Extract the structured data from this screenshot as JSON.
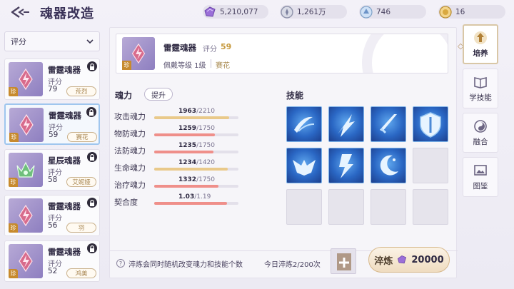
{
  "header": {
    "title": "魂器改造",
    "currencies": [
      {
        "icon": "purple-gem-icon",
        "value": "5,210,077"
      },
      {
        "icon": "silver-coin-icon",
        "value": "1,261万"
      },
      {
        "icon": "blue-crystal-icon",
        "value": "746"
      },
      {
        "icon": "gold-medal-icon",
        "value": "16"
      }
    ]
  },
  "filter": {
    "selected": "评分"
  },
  "list": {
    "items": [
      {
        "name": "雷霆魂器",
        "score_label": "评分",
        "score": "79",
        "owner": "荒烈",
        "rarity": "珍",
        "locked": true
      },
      {
        "name": "雷霆魂器",
        "score_label": "评分",
        "score": "59",
        "owner": "赛花",
        "rarity": "珍",
        "locked": true
      },
      {
        "name": "星辰魂器",
        "score_label": "评分",
        "score": "58",
        "owner": "艾妮娅",
        "rarity": "珍",
        "locked": true
      },
      {
        "name": "雷霆魂器",
        "score_label": "评分",
        "score": "56",
        "owner": "羽",
        "rarity": "珍",
        "locked": true
      },
      {
        "name": "雷霆魂器",
        "score_label": "评分",
        "score": "52",
        "owner": "鸿美",
        "rarity": "珍",
        "locked": true
      }
    ]
  },
  "selected_item": {
    "name": "雷霆魂器",
    "score_label": "评分",
    "score": "59",
    "wear_level": "佩戴等级 1级",
    "owner": "赛花",
    "rarity": "珍"
  },
  "soul_power": {
    "title": "魂力",
    "upgrade_label": "提升",
    "stats": [
      {
        "label": "攻击魂力",
        "current": "1963",
        "max": "/2210",
        "ratio": 0.888,
        "color": "#e9c98a"
      },
      {
        "label": "物防魂力",
        "current": "1259",
        "max": "/1750",
        "ratio": 0.72,
        "color": "#ef8f8a"
      },
      {
        "label": "法防魂力",
        "current": "1235",
        "max": "/1750",
        "ratio": 0.706,
        "color": "#ef8f8a"
      },
      {
        "label": "生命魂力",
        "current": "1234",
        "max": "/1420",
        "ratio": 0.869,
        "color": "#e9c98a"
      },
      {
        "label": "治疗魂力",
        "current": "1332",
        "max": "/1750",
        "ratio": 0.761,
        "color": "#ef8f8a"
      },
      {
        "label": "契合度",
        "current": "1.03",
        "max": "/1.19",
        "ratio": 0.866,
        "color": "#ef8f8a"
      }
    ]
  },
  "skills": {
    "title": "技能",
    "icons": [
      "wind-slash-icon",
      "lightning-spear-icon",
      "thunder-sword-icon",
      "shield-icon",
      "winged-emblem-icon",
      "lightning-strike-icon",
      "crescent-moon-icon"
    ]
  },
  "footer": {
    "info_text": "淬炼会同时随机改变魂力和技能个数",
    "today_text": "今日淬炼2/200次",
    "refine_label": "淬炼",
    "refine_cost": "20000"
  },
  "tabs": [
    {
      "label": "培养",
      "icon": "upgrade-icon",
      "active": true
    },
    {
      "label": "学技能",
      "icon": "book-icon",
      "active": false
    },
    {
      "label": "融合",
      "icon": "swirl-icon",
      "active": false
    },
    {
      "label": "图鉴",
      "icon": "gallery-icon",
      "active": false
    }
  ]
}
